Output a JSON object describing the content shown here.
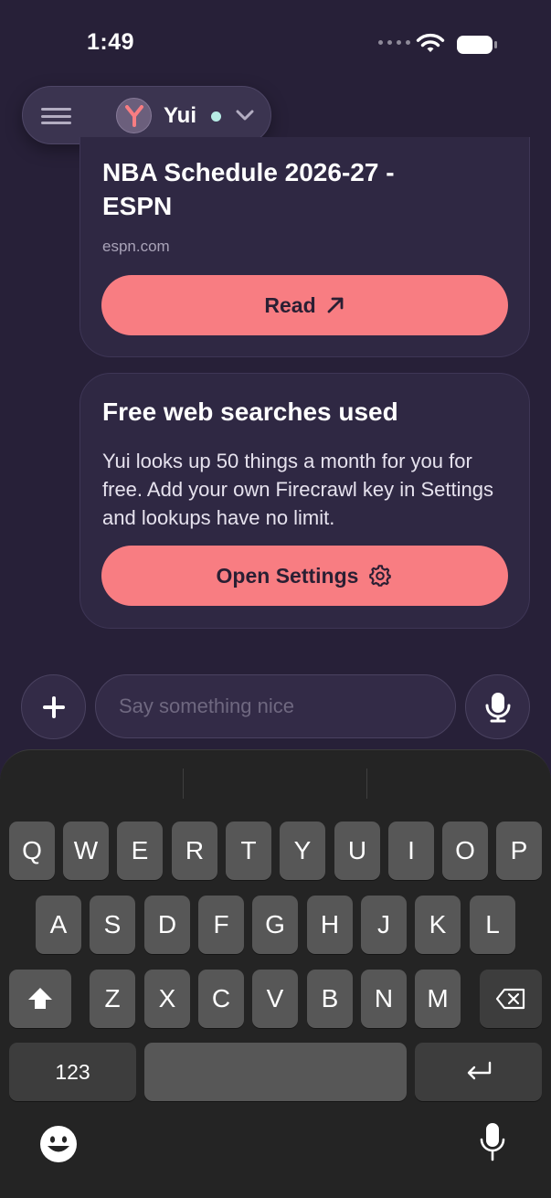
{
  "status_bar": {
    "time": "1:49"
  },
  "header": {
    "agent_name": "Yui",
    "avatar_letter": "Y",
    "online_color": "#b8ede6"
  },
  "cards": [
    {
      "title": "NBA Schedule 2026-27 - ESPN",
      "domain": "espn.com",
      "button_label": "Read",
      "button_icon": "arrow-up-right-icon"
    },
    {
      "title": "Free web searches used",
      "body": "Yui looks up 50 things a month for you for free. Add your own Firecrawl key in Settings and lookups have no limit.",
      "button_label": "Open Settings",
      "button_icon": "gear-icon"
    }
  ],
  "composer": {
    "placeholder": "Say something nice",
    "value": ""
  },
  "keyboard": {
    "row1": [
      "Q",
      "W",
      "E",
      "R",
      "T",
      "Y",
      "U",
      "I",
      "O",
      "P"
    ],
    "row2": [
      "A",
      "S",
      "D",
      "F",
      "G",
      "H",
      "J",
      "K",
      "L"
    ],
    "row3": [
      "Z",
      "X",
      "C",
      "V",
      "B",
      "N",
      "M"
    ],
    "numbers_label": "123"
  },
  "colors": {
    "background": "#272038",
    "card": "#2f2843",
    "accent_button": "#f87d82"
  }
}
